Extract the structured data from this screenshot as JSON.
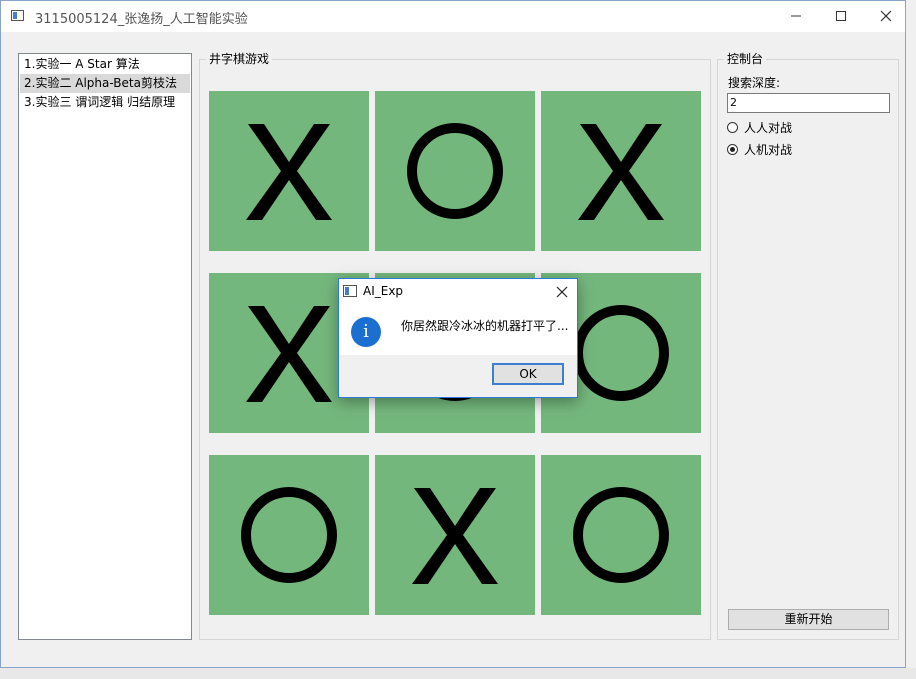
{
  "window": {
    "title": "3115005124_张逸扬_人工智能实验",
    "minimize_icon": "minimize-icon",
    "maximize_icon": "maximize-icon",
    "close_icon": "close-icon"
  },
  "experiments": {
    "items": [
      {
        "label": "1.实验一  A Star 算法",
        "selected": false
      },
      {
        "label": "2.实验二  Alpha-Beta剪枝法",
        "selected": true
      },
      {
        "label": "3.实验三  谓词逻辑 归结原理",
        "selected": false
      }
    ]
  },
  "game": {
    "title": "井字棋游戏",
    "cell_color": "#74b77d",
    "mark_color": "#000000",
    "board": [
      [
        "X",
        "O",
        "X"
      ],
      [
        "X",
        "O",
        "O"
      ],
      [
        "O",
        "X",
        "O"
      ]
    ]
  },
  "console": {
    "title": "控制台",
    "depth_label": "搜索深度:",
    "depth_value": "2",
    "modes": [
      {
        "label": "人人对战",
        "checked": false
      },
      {
        "label": "人机对战",
        "checked": true
      }
    ],
    "restart_label": "重新开始"
  },
  "dialog": {
    "title": "AI_Exp",
    "message": "你居然跟冷冰冰的机器打平了...",
    "icon": "info-icon",
    "icon_glyph": "i",
    "ok_label": "OK",
    "accent": "#1a6fd0"
  }
}
